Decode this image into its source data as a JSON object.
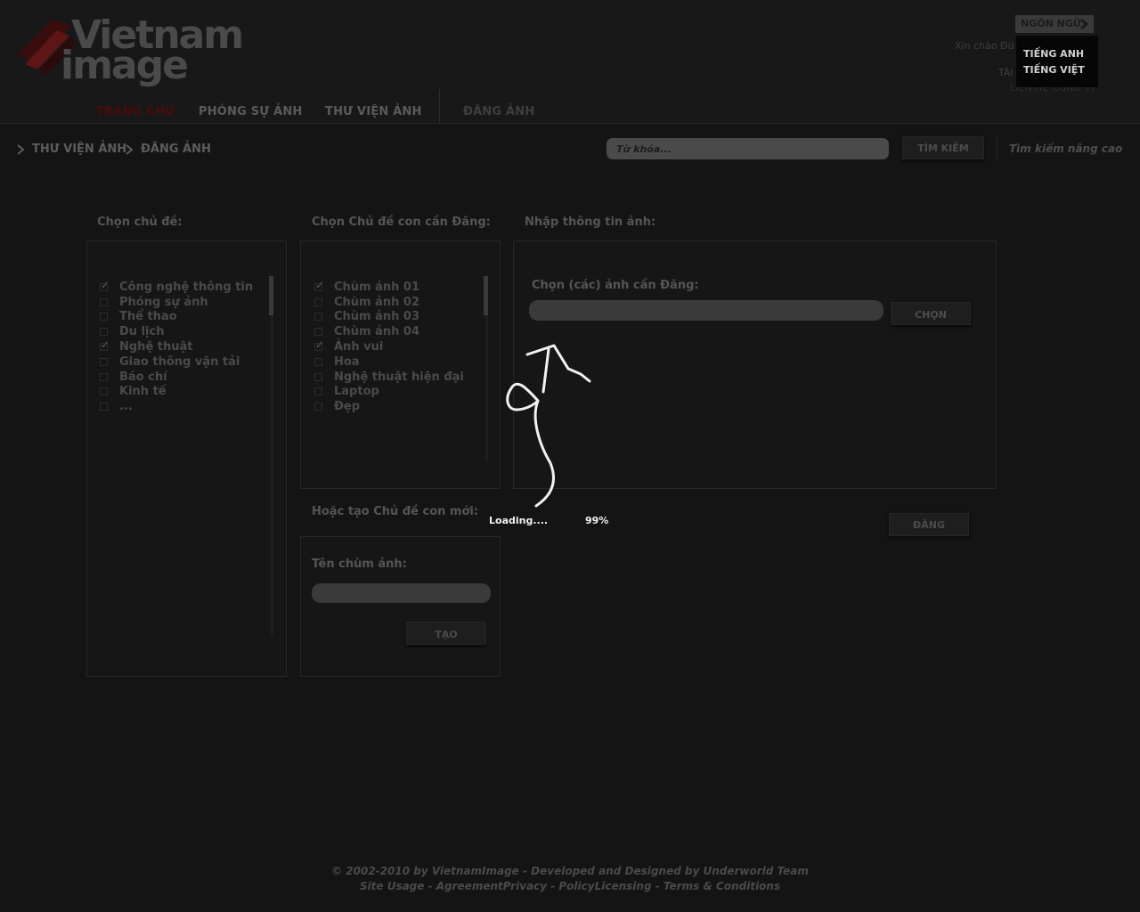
{
  "header": {
    "logo": {
      "line1": "Vietnam",
      "line2": "image"
    },
    "nav": [
      {
        "label": "TRANG CHỦ",
        "active": true
      },
      {
        "label": "PHÓNG SỰ ẢNH"
      },
      {
        "label": "THƯ VIỆN ẢNH"
      },
      {
        "label": "ĐĂNG ẢNH"
      }
    ],
    "language": {
      "label": "NGÔN NGỮ",
      "options": [
        "TIẾNG ANH",
        "TIẾNG VIỆT"
      ]
    },
    "greeting": "Xin chào Đứ",
    "account": "TÀI",
    "contact": "LIÊN HỆ CÔNG TY"
  },
  "breadcrumb": [
    "THƯ VIỆN ẢNH",
    "ĐĂNG ẢNH"
  ],
  "search": {
    "placeholder": "Từ khóa...",
    "button": "TÌM KIẾM",
    "advanced": "Tìm kiếm nâng cao"
  },
  "topics": {
    "title": "Chọn chủ đề:",
    "items": [
      {
        "label": "Công nghệ thông tin",
        "checked": true
      },
      {
        "label": "Phóng sự ảnh",
        "checked": false
      },
      {
        "label": "Thể thao",
        "checked": false
      },
      {
        "label": "Du lịch",
        "checked": false
      },
      {
        "label": "Nghệ thuật",
        "checked": true
      },
      {
        "label": "Giao thông vận tải",
        "checked": false
      },
      {
        "label": "Báo chí",
        "checked": false
      },
      {
        "label": "Kinh tế",
        "checked": false
      },
      {
        "label": "...",
        "checked": false
      }
    ]
  },
  "subtopics": {
    "title": "Chọn Chủ đề con cần Đăng:",
    "items": [
      {
        "label": "Chùm ảnh 01",
        "checked": true
      },
      {
        "label": "Chùm ảnh 02",
        "checked": false
      },
      {
        "label": "Chùm ảnh 03",
        "checked": false
      },
      {
        "label": "Chùm ảnh 04",
        "checked": false
      },
      {
        "label": "Ảnh vui",
        "checked": true
      },
      {
        "label": "Hoa",
        "checked": false
      },
      {
        "label": "Nghệ thuật hiện đại",
        "checked": false
      },
      {
        "label": "Laptop",
        "checked": false
      },
      {
        "label": "Đẹp",
        "checked": false
      }
    ]
  },
  "image_info": {
    "title": "Nhập thông tin ảnh:",
    "choose_label": "Chọn (các) ảnh cần Đăng:",
    "choose_button": "CHỌN",
    "post_button": "ĐĂNG"
  },
  "new_subtopic": {
    "title": "Hoặc tạo Chủ đề con mới:",
    "name_label": "Tên chùm ảnh:",
    "create_button": "TẠO"
  },
  "loader": {
    "text": "Loading....",
    "percent": "99%"
  },
  "footer": {
    "line1": "© 2002-2010 by VietnamImage - Developed and Designed by Underworld Team",
    "line2": "Site Usage - AgreementPrivacy  - PolicyLicensing - Terms & Conditions"
  },
  "colors": {
    "accent": "#8b1a1a",
    "background": "#141414"
  }
}
